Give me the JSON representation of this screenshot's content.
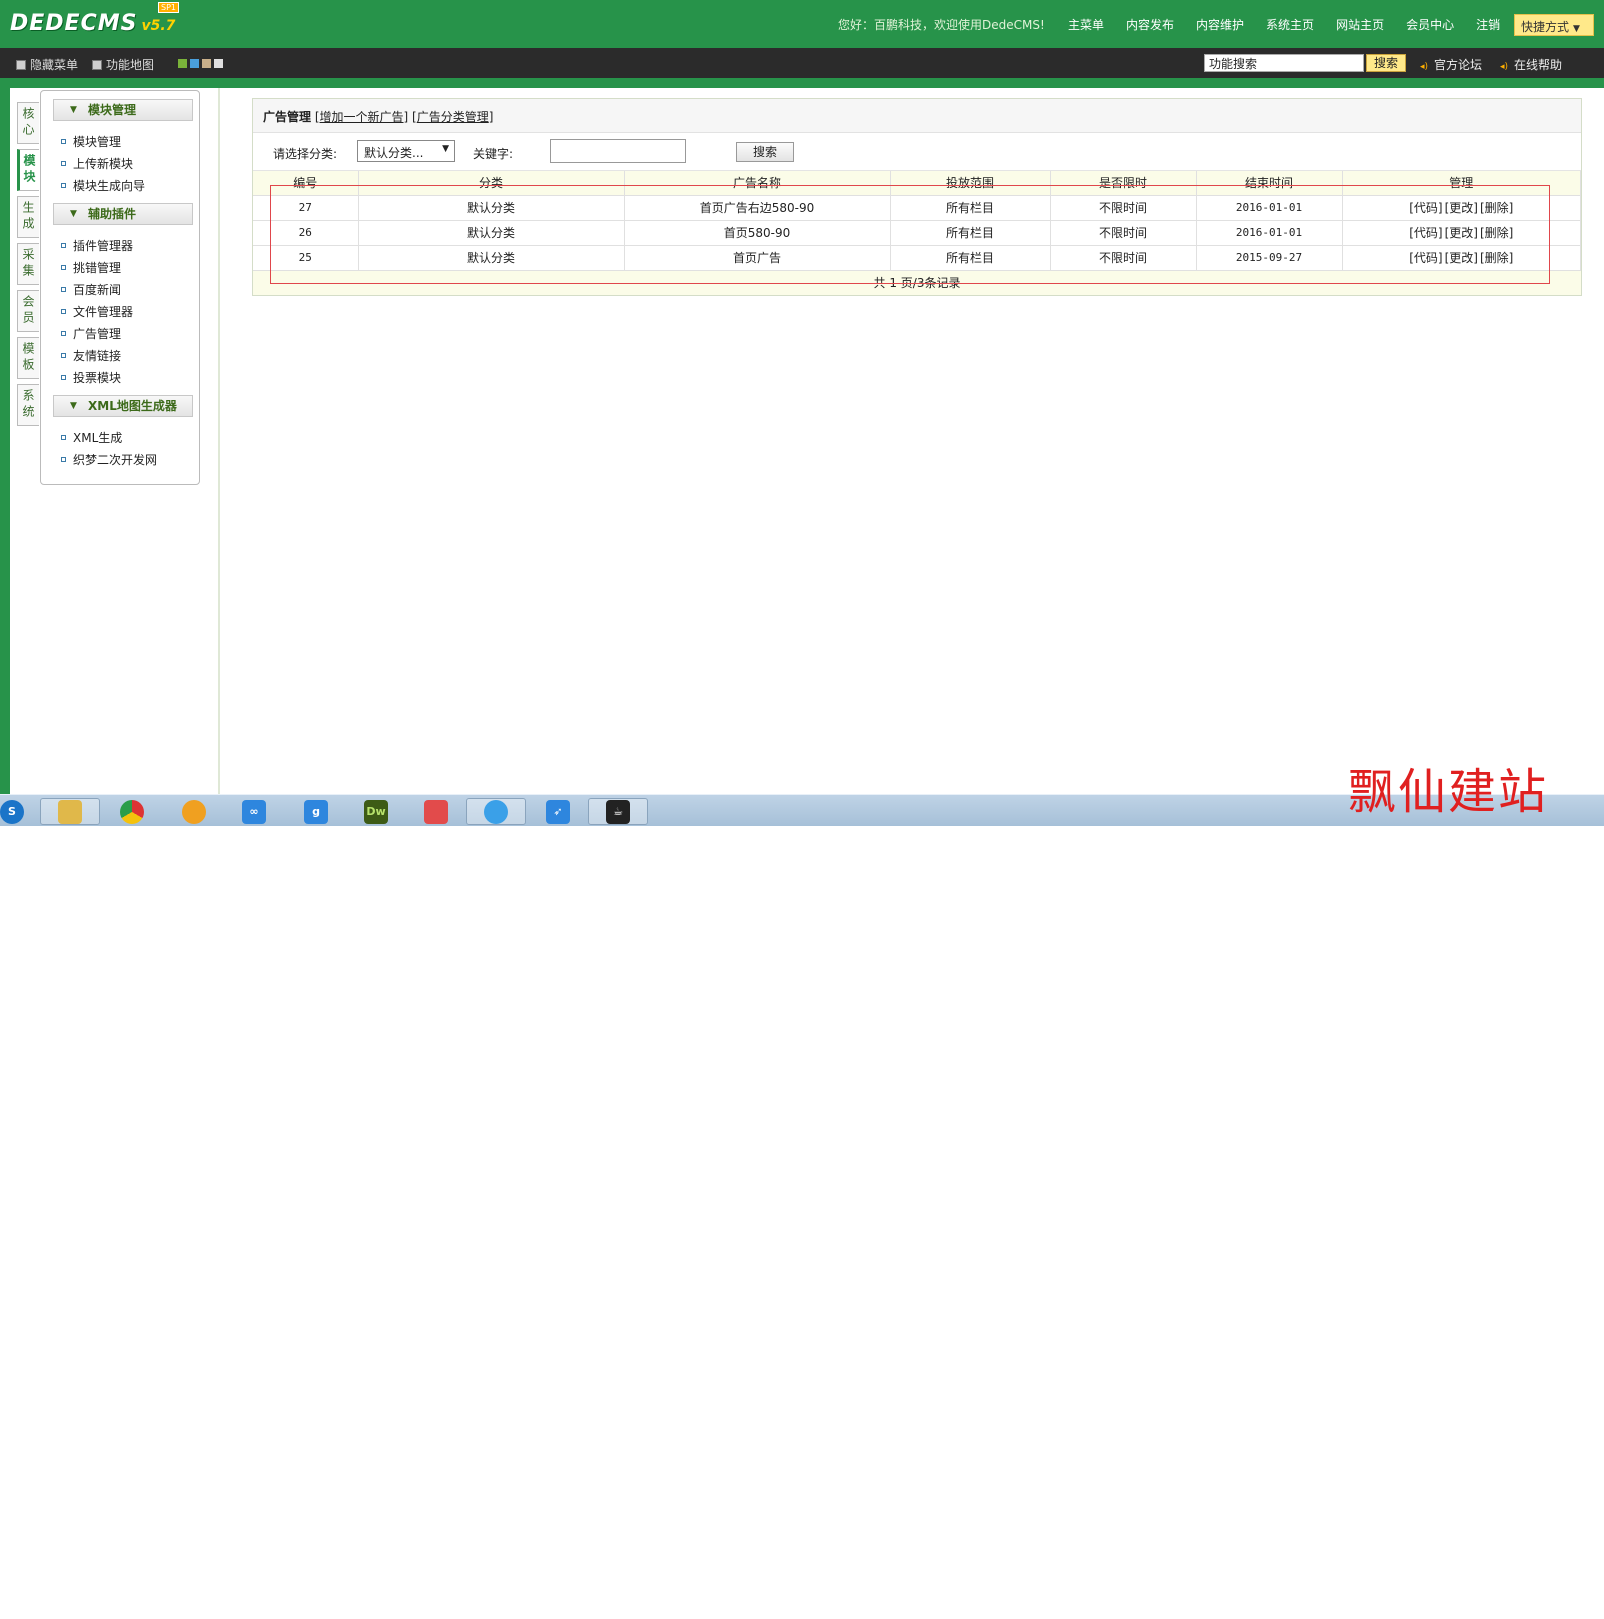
{
  "header": {
    "brand": "DEDECMS",
    "version": "v5.7",
    "version_badge": "SP1",
    "welcome": "您好：百鹏科技，欢迎使用DedeCMS!",
    "nav": [
      "主菜单",
      "内容发布",
      "内容维护",
      "系统主页",
      "网站主页",
      "会员中心",
      "注销"
    ],
    "quick_label": "快捷方式"
  },
  "toolbar": {
    "hide_menu": "隐藏菜单",
    "func_map": "功能地图",
    "skin_colors": [
      "#7ab33a",
      "#4aa0dc",
      "#c9b08a",
      "#e0e0e0"
    ],
    "search_value": "功能搜索",
    "search_button": "搜索",
    "forum": "官方论坛",
    "help": "在线帮助"
  },
  "side_tabs": [
    "核心",
    "模块",
    "生成",
    "采集",
    "会员",
    "模板",
    "系统"
  ],
  "sidebar": {
    "groups": [
      {
        "title": "模块管理",
        "items": [
          "模块管理",
          "上传新模块",
          "模块生成向导"
        ]
      },
      {
        "title": "辅助插件",
        "items": [
          "插件管理器",
          "挑错管理",
          "百度新闻",
          "文件管理器",
          "广告管理",
          "友情链接",
          "投票模块"
        ]
      },
      {
        "title": "XML地图生成器",
        "items": [
          "XML生成",
          "织梦二次开发网"
        ]
      }
    ]
  },
  "main": {
    "title": "广告管理",
    "link_add": "增加一个新广告",
    "link_cat": "广告分类管理",
    "filter": {
      "cat_label": "请选择分类:",
      "cat_value": "默认分类...",
      "kw_label": "关键字:",
      "kw_value": "",
      "search_button": "搜索"
    },
    "columns": [
      "编号",
      "分类",
      "广告名称",
      "投放范围",
      "是否限时",
      "结束时间",
      "管理"
    ],
    "rows": [
      {
        "id": "27",
        "cat": "默认分类",
        "name": "首页广告右边580-90",
        "scope": "所有栏目",
        "limit": "不限时间",
        "end": "2016-01-01"
      },
      {
        "id": "26",
        "cat": "默认分类",
        "name": "首页580-90",
        "scope": "所有栏目",
        "limit": "不限时间",
        "end": "2016-01-01"
      },
      {
        "id": "25",
        "cat": "默认分类",
        "name": "首页广告",
        "scope": "所有栏目",
        "limit": "不限时间",
        "end": "2015-09-27"
      }
    ],
    "actions": [
      "[代码]",
      "[更改]",
      "[删除]"
    ],
    "pager": "共 1 页/3条记录"
  },
  "taskbar": {
    "apps": [
      "start-orb",
      "file-explorer",
      "chrome",
      "sogou",
      "network-share",
      "baidu-pinyin",
      "dreamweaver",
      "notepad",
      "qq-browser",
      "feiyu",
      "media-player"
    ]
  },
  "watermark": "飘仙建站"
}
